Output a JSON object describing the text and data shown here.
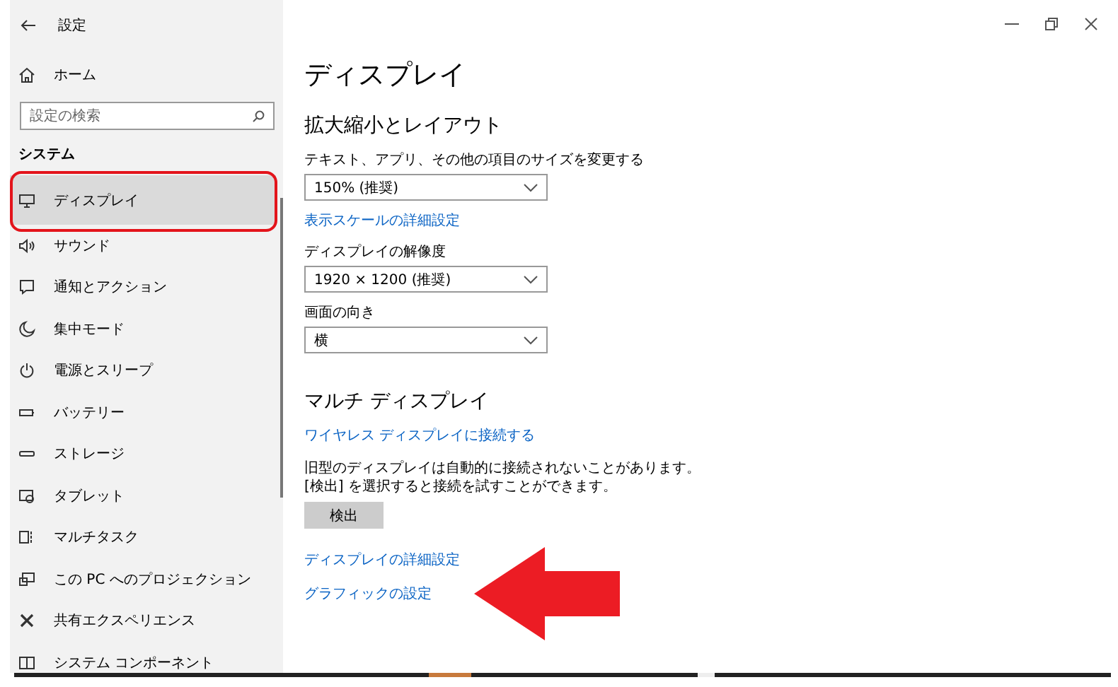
{
  "window": {
    "title": "設定"
  },
  "sidebar": {
    "home": "ホーム",
    "search": {
      "placeholder": "設定の検索"
    },
    "section": "システム",
    "items": [
      {
        "label": "ディスプレイ",
        "selected": true
      },
      {
        "label": "サウンド",
        "selected": false
      },
      {
        "label": "通知とアクション",
        "selected": false
      },
      {
        "label": "集中モード",
        "selected": false
      },
      {
        "label": "電源とスリープ",
        "selected": false
      },
      {
        "label": "バッテリー",
        "selected": false
      },
      {
        "label": "ストレージ",
        "selected": false
      },
      {
        "label": "タブレット",
        "selected": false
      },
      {
        "label": "マルチタスク",
        "selected": false
      },
      {
        "label": "この PC へのプロジェクション",
        "selected": false
      },
      {
        "label": "共有エクスペリエンス",
        "selected": false
      },
      {
        "label": "システム コンポーネント",
        "selected": false
      }
    ]
  },
  "main": {
    "title": "ディスプレイ",
    "sections": [
      {
        "heading": "拡大縮小とレイアウト",
        "controls": [
          {
            "kind": "dropdown",
            "label": "テキスト、アプリ、その他の項目のサイズを変更する",
            "value": "150% (推奨)"
          },
          {
            "kind": "link",
            "text": "表示スケールの詳細設定"
          },
          {
            "kind": "dropdown",
            "label": "ディスプレイの解像度",
            "value": "1920 × 1200 (推奨)"
          },
          {
            "kind": "dropdown",
            "label": "画面の向き",
            "value": "横"
          }
        ]
      },
      {
        "heading": "マルチ ディスプレイ",
        "controls": [
          {
            "kind": "link",
            "text": "ワイヤレス ディスプレイに接続する"
          },
          {
            "kind": "text",
            "text": "旧型のディスプレイは自動的に接続されないことがあります。[検出] を選択すると接続を試すことができます。"
          },
          {
            "kind": "button",
            "text": "検出"
          },
          {
            "kind": "link",
            "text": "ディスプレイの詳細設定"
          },
          {
            "kind": "link",
            "text": "グラフィックの設定"
          }
        ]
      }
    ]
  }
}
